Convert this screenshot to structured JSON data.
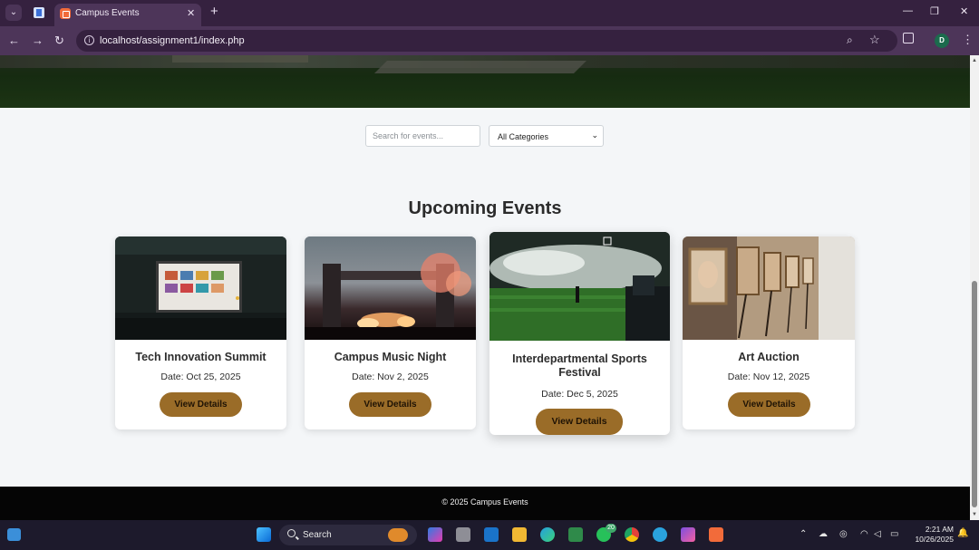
{
  "browser": {
    "active_tab_title": "Campus Events",
    "address": "localhost/assignment1/index.php",
    "profile_initial": "D",
    "new_tab_symbol": "+",
    "close_tab_symbol": "✕"
  },
  "page": {
    "search": {
      "placeholder": "Search for events..."
    },
    "category_filter": {
      "selected": "All Categories"
    },
    "section_title": "Upcoming Events",
    "events": [
      {
        "title": "Tech Innovation Summit",
        "date": "Date: Oct 25, 2025",
        "button": "View Details"
      },
      {
        "title": "Campus Music Night",
        "date": "Date: Nov 2, 2025",
        "button": "View Details"
      },
      {
        "title": "Interdepartmental Sports Festival",
        "date": "Date: Dec 5, 2025",
        "button": "View Details"
      },
      {
        "title": "Art Auction",
        "date": "Date: Nov 12, 2025",
        "button": "View Details"
      }
    ],
    "footer": "© 2025 Campus Events",
    "accent_color": "#9a6c28"
  },
  "taskbar": {
    "search_label": "Search",
    "whatsapp_badge": "20",
    "time": "2:21 AM",
    "date": "10/26/2025"
  }
}
